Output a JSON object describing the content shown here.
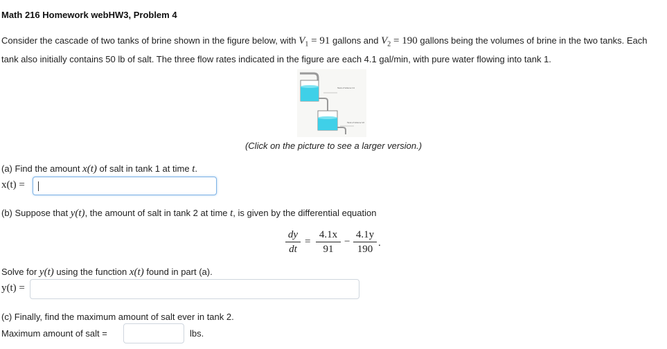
{
  "header": {
    "title": "Math 216 Homework webHW3, Problem 4"
  },
  "intro": {
    "part1": "Consider the cascade of two tanks of brine shown in the figure below, with ",
    "v1_sym": "V",
    "v1_sub": "1",
    "v1_eq": " = 91",
    "part2": " gallons and ",
    "v2_sym": "V",
    "v2_sub": "2",
    "v2_eq": " = 190",
    "part3": " gallons being the volumes of brine in the two tanks. Each tank also initially contains 50 lb of salt. The three flow rates indicated in the figure are each 4.1 gal/min, with pure water flowing into tank 1."
  },
  "figure": {
    "tank1_label": "Tank of Volume V1",
    "tank2_label": "Tank of Volume V2",
    "caption": "(Click on the picture to see a larger version.)"
  },
  "part_a": {
    "prompt_pre": "(a) Find the amount ",
    "prompt_fn": "x(t)",
    "prompt_mid": " of salt in tank 1 at time ",
    "prompt_t": "t",
    "prompt_post": ".",
    "lhs": "x(t) =",
    "value": ""
  },
  "part_b": {
    "prompt_pre": "(b) Suppose that ",
    "prompt_fn": "y(t)",
    "prompt_mid": ", the amount of salt in tank 2 at time ",
    "prompt_t": "t",
    "prompt_post": ", is given by the differential equation",
    "eq_dy": "dy",
    "eq_dt": "dt",
    "eq_equals": "=",
    "eq_num1": "4.1x",
    "eq_den1": "91",
    "eq_minus": "−",
    "eq_num2": "4.1y",
    "eq_den2": "190",
    "eq_end": ".",
    "solve_pre": "Solve for ",
    "solve_fn": "y(t)",
    "solve_mid": " using the function ",
    "solve_fn2": "x(t)",
    "solve_post": " found in part (a).",
    "lhs": "y(t) =",
    "value": ""
  },
  "part_c": {
    "prompt": "(c) Finally, find the maximum amount of salt ever in tank 2.",
    "label": "Maximum amount of salt =",
    "value": "",
    "units": "lbs."
  },
  "colors": {
    "water": "#3fd0e8",
    "tank_outline": "#888888",
    "active_border": "#7fb3e6"
  }
}
